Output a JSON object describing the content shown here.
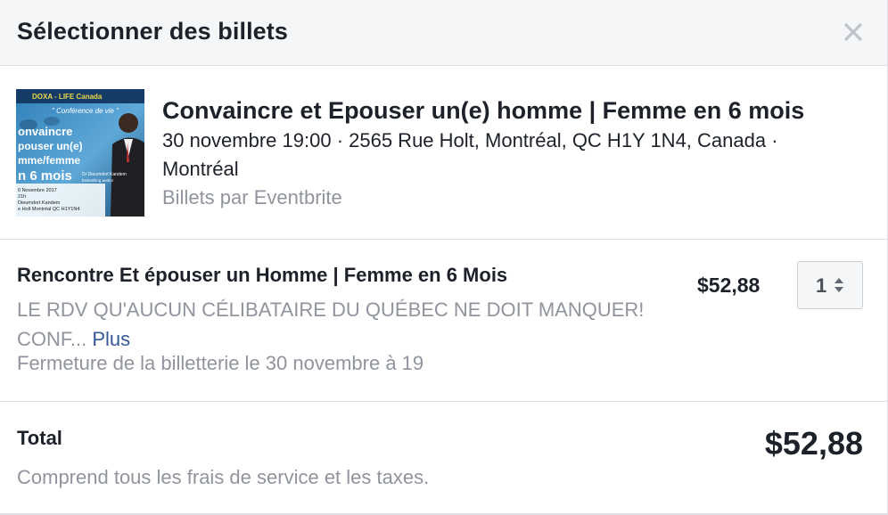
{
  "dialog": {
    "title": "Sélectionner des billets",
    "close_icon": "close-icon"
  },
  "event": {
    "title": "Convaincre et Epouser un(e) homme | Femme en 6 mois",
    "details_line1": "30 novembre 19:00 · 2565 Rue Holt, Montréal, QC H1Y 1N4, Canada ·",
    "details_line2": "Montréal",
    "provider": "Billets par Eventbrite",
    "poster": {
      "header": "DOXA - LIFE Canada",
      "subtitle": "\" Conférence de vie \"",
      "line1": "onvaincre",
      "line2": "pouser un(e)",
      "line3": "mme/femme",
      "line4": "n 6 mois",
      "date": "0 Novembre 2017",
      "time": "21h",
      "venue1": "Dieumdort Kandem",
      "venue2": "e Holt Montréal QC H1Y1N4",
      "speaker1": "Dr Dieumdort Kandem",
      "speaker2": "bestselling author"
    }
  },
  "ticket": {
    "name": "Rencontre Et épouser un Homme | Femme en 6 Mois",
    "description": "LE RDV QU'AUCUN CÉLIBATAIRE DU QUÉBEC NE DOIT MANQUER! CONF...",
    "more_label": "Plus",
    "closing": "Fermeture de la billetterie le 30 novembre à 19",
    "price": "$52,88",
    "quantity": "1",
    "quantity_icon": "select-arrows-icon"
  },
  "total": {
    "label": "Total",
    "note": "Comprend tous les frais de service et les taxes.",
    "amount": "$52,88"
  },
  "colors": {
    "header_bg": "#f5f6f7",
    "border": "#dddfe2",
    "text_primary": "#1d2129",
    "text_secondary": "#90949c",
    "link": "#365899"
  }
}
